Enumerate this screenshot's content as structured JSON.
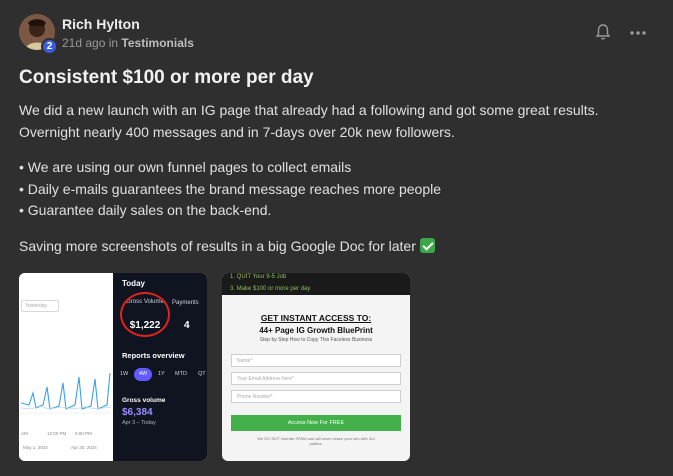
{
  "post": {
    "author": "Rich Hylton",
    "level_badge": "2",
    "time_ago": "21d ago",
    "in_label": "in",
    "category": "Testimonials",
    "title": "Consistent $100 or more per day",
    "paragraph1_line1": "We did a new launch with an IG page that already had a following and got some great results.",
    "paragraph1_line2": "Overnight nearly 400 messages and in 7-days over 20k new followers.",
    "bullets": [
      "• We are using our own funnel pages to collect emails",
      "• Daily e-mails guarantees the brand message reaches more people",
      "• Guarantee daily sales on the back-end."
    ],
    "closing": "Saving more screenshots of results in a big Google Doc for later",
    "icons": {
      "bell": "bell-off-icon",
      "more": "more-horizontal-icon",
      "check": "check-mark-emoji-icon"
    },
    "accent_check_color": "#3aa847"
  },
  "attachments": {
    "stripe": {
      "search_placeholder": "Yesterday",
      "today": "Today",
      "gross_label": "Gross Volume",
      "gross_value": "$1,222",
      "payments_label": "Payments",
      "payments_value": "4",
      "reports_title": "Reports overview",
      "ranges": [
        "1W",
        "4W",
        "1Y",
        "MTD",
        "QT"
      ],
      "active_range": "4W",
      "gross_volume_label": "Gross volume",
      "gross_volume_value": "$6,384",
      "gross_volume_range": "Apr 3 – Today",
      "axis_times": [
        "AM",
        "12:00 PM",
        "6:00 PM"
      ],
      "axis_dates": [
        "May 1, 2024",
        "Apr 30, 2024"
      ]
    },
    "optin": {
      "line1": "1. QUIT Your 9-5 Job",
      "line2": "3. Make $100 or more per day",
      "get_access": "GET INSTANT ACCESS TO:",
      "headline": "44+ Page IG Growth BluePrint",
      "subheadline": "Step by Step How to Copy This Faceless Business",
      "name_placeholder": "Name*",
      "email_placeholder": "Your Email Address here*",
      "phone_placeholder": "Phone Number*",
      "button": "Access Now For FREE",
      "fine_print": "We DO NOT tolerate SPAM and will never share your info with 3rd parties."
    }
  }
}
